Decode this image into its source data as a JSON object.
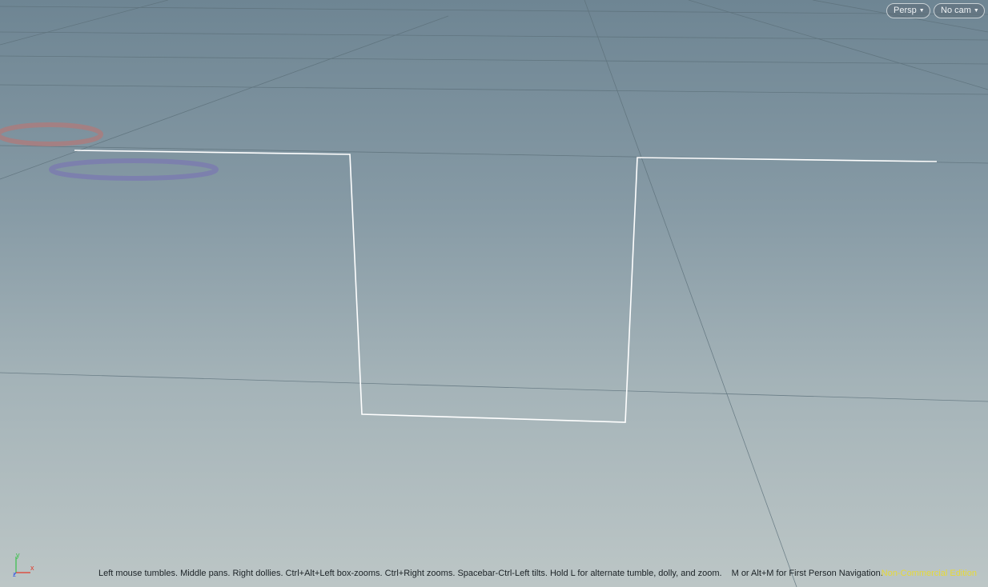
{
  "viewport": {
    "view_menu": {
      "label": "Persp"
    },
    "camera_menu": {
      "label": "No cam"
    },
    "help_text": {
      "navigation": "Left mouse tumbles. Middle pans. Right dollies. Ctrl+Alt+Left box-zooms. Ctrl+Right zooms. Spacebar-Ctrl-Left tilts. Hold L for alternate tumble, dolly, and zoom.",
      "first_person": "M or Alt+M for First Person Navigation."
    },
    "edition_label": "Non-Commercial Edition",
    "axis_gizmo": {
      "y_label": "y",
      "x_label": "x",
      "z_label": "z"
    },
    "colors": {
      "background_top": "#6e8593",
      "background_bottom": "#bcc6c6",
      "grid": "#5a6e78",
      "curve": "#ffffff",
      "edition_text": "#e6d93a",
      "axis_x": "#e23a2a",
      "axis_y": "#3ac24a",
      "axis_z": "#3a5ae2"
    }
  }
}
